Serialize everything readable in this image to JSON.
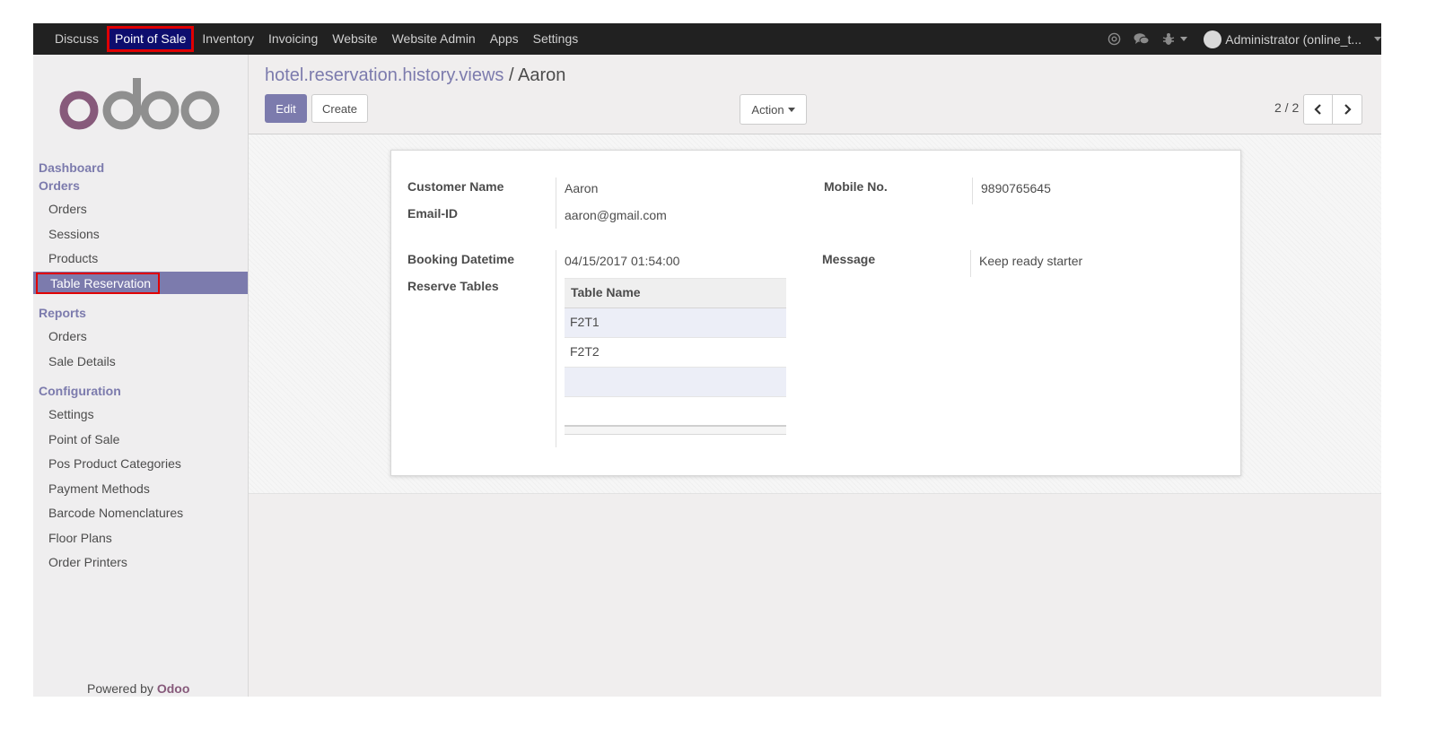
{
  "topbar": {
    "menu": [
      "Discuss",
      "Point of Sale",
      "Inventory",
      "Invoicing",
      "Website",
      "Website Admin",
      "Apps",
      "Settings"
    ],
    "active_menu": "Point of Sale",
    "user_label": "Administrator (online_t..."
  },
  "sidebar": {
    "logo_text": "odoo",
    "dashboard": "Dashboard",
    "orders_title": "Orders",
    "orders_items": [
      "Orders",
      "Sessions",
      "Products",
      "Table Reservation"
    ],
    "reports_title": "Reports",
    "reports_items": [
      "Orders",
      "Sale Details"
    ],
    "config_title": "Configuration",
    "config_items": [
      "Settings",
      "Point of Sale",
      "Pos Product Categories",
      "Payment Methods",
      "Barcode Nomenclatures",
      "Floor Plans",
      "Order Printers"
    ],
    "powered_prefix": "Powered by",
    "powered_brand": "Odoo"
  },
  "control": {
    "breadcrumb_parent": "hotel.reservation.history.views",
    "breadcrumb_sep": "/",
    "breadcrumb_current": "Aaron",
    "edit_label": "Edit",
    "create_label": "Create",
    "action_label": "Action",
    "pager": "2 / 2"
  },
  "form": {
    "customer_name_label": "Customer Name",
    "customer_name": "Aaron",
    "email_label": "Email-ID",
    "email": "aaron@gmail.com",
    "mobile_label": "Mobile No.",
    "mobile": "9890765645",
    "booking_label": "Booking Datetime",
    "booking": "04/15/2017 01:54:00",
    "message_label": "Message",
    "message": "Keep ready starter",
    "reserve_label": "Reserve Tables",
    "table_header": "Table Name",
    "tables": [
      "F2T1",
      "F2T2"
    ]
  },
  "colors": {
    "accent": "#7c7bad",
    "topbar": "#212121",
    "highlight_border": "#e00000",
    "brand_purple": "#875a7b",
    "logo_gray": "#8f8f8f"
  }
}
